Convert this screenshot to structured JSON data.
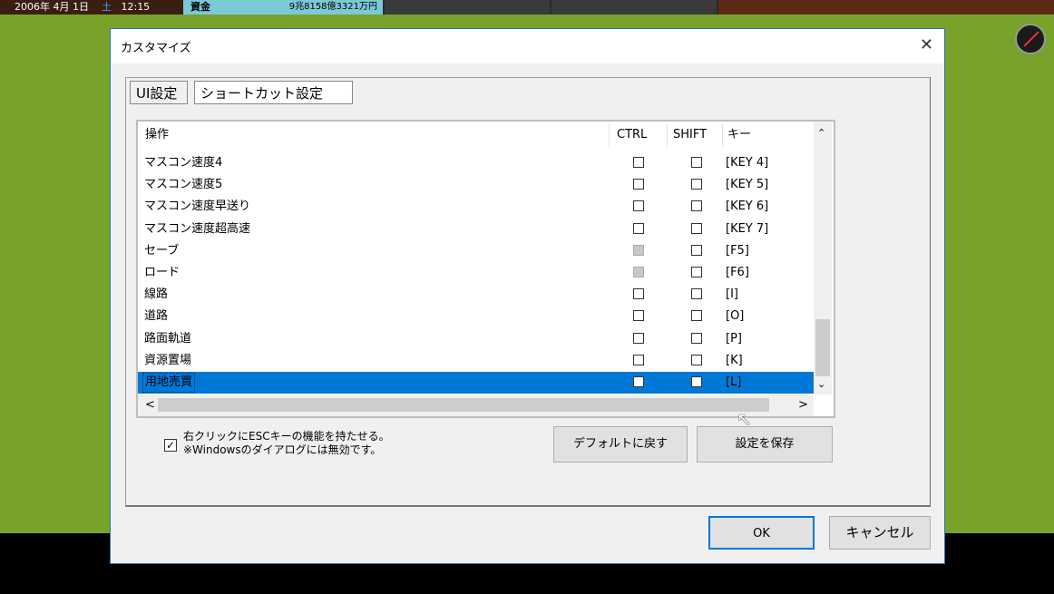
{
  "topbar": {
    "date": "2006年 4月 1日",
    "weekday": "土",
    "time": "12:15",
    "funds_label": "資金",
    "funds_value": "9兆8158億3321万円"
  },
  "dialog": {
    "title": "カスタマイズ",
    "tabs": [
      "UI設定",
      "ショートカット設定"
    ],
    "columns": {
      "action": "操作",
      "ctrl": "CTRL",
      "shift": "SHIFT",
      "key": "キー"
    },
    "rows": [
      {
        "action": "マスコン速度4",
        "ctrl": "unchecked",
        "shift": "unchecked",
        "key": "[KEY 4]"
      },
      {
        "action": "マスコン速度5",
        "ctrl": "unchecked",
        "shift": "unchecked",
        "key": "[KEY 5]"
      },
      {
        "action": "マスコン速度早送り",
        "ctrl": "unchecked",
        "shift": "unchecked",
        "key": "[KEY 6]"
      },
      {
        "action": "マスコン速度超高速",
        "ctrl": "unchecked",
        "shift": "unchecked",
        "key": "[KEY 7]"
      },
      {
        "action": "セーブ",
        "ctrl": "disabled",
        "shift": "unchecked",
        "key": "[F5]"
      },
      {
        "action": "ロード",
        "ctrl": "disabled",
        "shift": "unchecked",
        "key": "[F6]"
      },
      {
        "action": "線路",
        "ctrl": "unchecked",
        "shift": "unchecked",
        "key": "[I]"
      },
      {
        "action": "道路",
        "ctrl": "unchecked",
        "shift": "unchecked",
        "key": "[O]"
      },
      {
        "action": "路面軌道",
        "ctrl": "unchecked",
        "shift": "unchecked",
        "key": "[P]"
      },
      {
        "action": "資源置場",
        "ctrl": "unchecked",
        "shift": "unchecked",
        "key": "[K]"
      },
      {
        "action": "用地売買",
        "ctrl": "unchecked",
        "shift": "unchecked",
        "key": "[L]",
        "selected": true
      }
    ],
    "esc_option": {
      "checked": true,
      "line1": "右クリックにESCキーの機能を持たせる。",
      "line2": "※Windowsのダイアログには無効です。"
    },
    "buttons": {
      "default": "デフォルトに戻す",
      "save": "設定を保存",
      "ok": "OK",
      "cancel": "キャンセル"
    }
  },
  "icons": {
    "close": "✕",
    "scroll_up": "⌃",
    "scroll_down": "⌄",
    "scroll_left": "<",
    "scroll_right": ">",
    "compass": "compass-icon",
    "check": "✓"
  }
}
